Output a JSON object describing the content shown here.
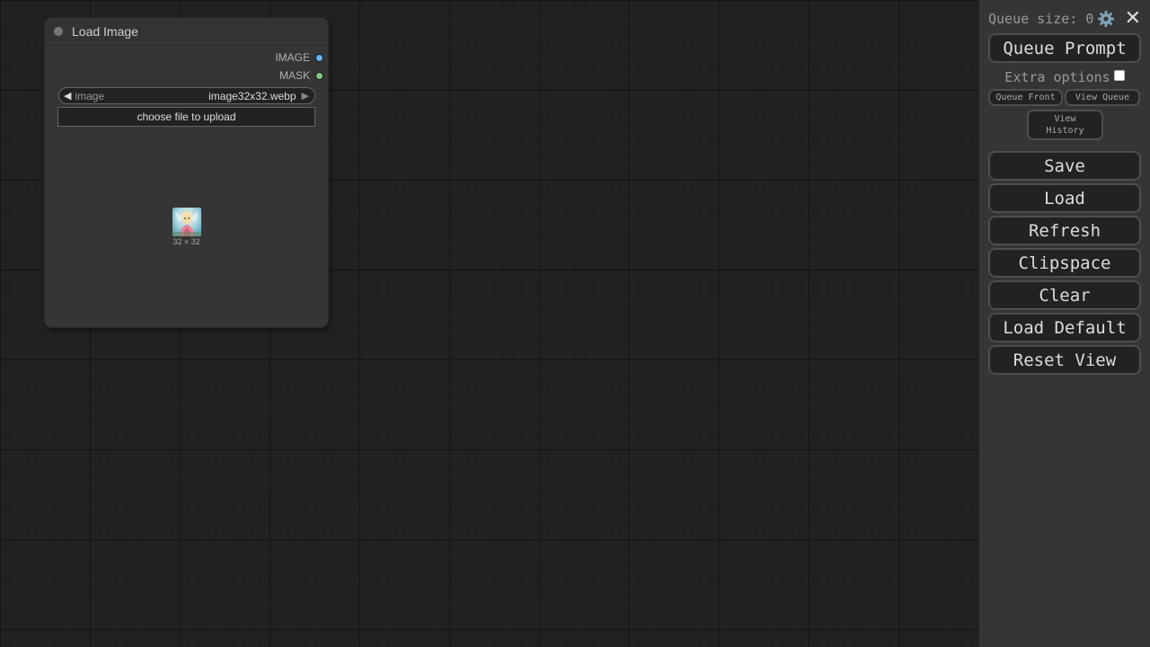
{
  "node": {
    "title": "Load Image",
    "outputs": [
      {
        "label": "IMAGE",
        "color": "#64B5F6"
      },
      {
        "label": "MASK",
        "color": "#81C784"
      }
    ],
    "combo": {
      "name": "image",
      "value": "image32x32.webp"
    },
    "upload_label": "choose file to upload",
    "preview_caption": "32 × 32"
  },
  "menu": {
    "queue_size_label": "Queue size: 0",
    "queue_prompt": "Queue Prompt",
    "extra_options": "Extra options",
    "extra_options_checked": false,
    "queue_front": "Queue Front",
    "view_queue": "View Queue",
    "view_history": "View\nHistory",
    "buttons": [
      "Save",
      "Load",
      "Refresh",
      "Clipspace",
      "Clear",
      "Load Default",
      "Reset View"
    ]
  },
  "icons": {
    "settings": "gear-icon",
    "close": "close-icon",
    "left": "arrow-left-icon",
    "right": "arrow-right-icon"
  }
}
